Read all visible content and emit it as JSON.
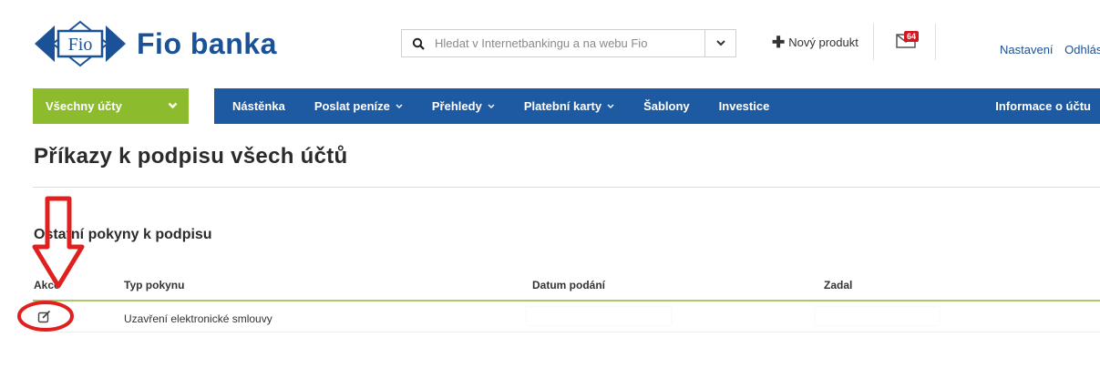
{
  "brand": {
    "name": "Fio banka",
    "logo_text": "Fio"
  },
  "search": {
    "placeholder": "Hledat v Internetbankingu a na webu Fio"
  },
  "header": {
    "new_product": "Nový produkt",
    "mail_count": "64",
    "settings": "Nastavení",
    "logout": "Odhlásit"
  },
  "nav": {
    "accounts_select": "Všechny účty",
    "items": [
      "Nástěnka",
      "Poslat peníze",
      "Přehledy",
      "Platební karty",
      "Šablony",
      "Investice"
    ],
    "account_info": "Informace o účtu"
  },
  "page": {
    "title": "Příkazy k podpisu všech účtů"
  },
  "section": {
    "title": "Ostatní pokyny k podpisu",
    "columns": [
      "Akce",
      "Typ pokynu",
      "Datum podání",
      "Zadal"
    ],
    "rows": [
      {
        "type": "Uzavření elektronické smlouvy"
      }
    ]
  },
  "colors": {
    "brand_blue": "#1b5196",
    "nav_blue": "#1d5aa1",
    "accent_green": "#8cbc2e",
    "badge_red": "#d3181f",
    "annotation_red": "#e0201f"
  }
}
